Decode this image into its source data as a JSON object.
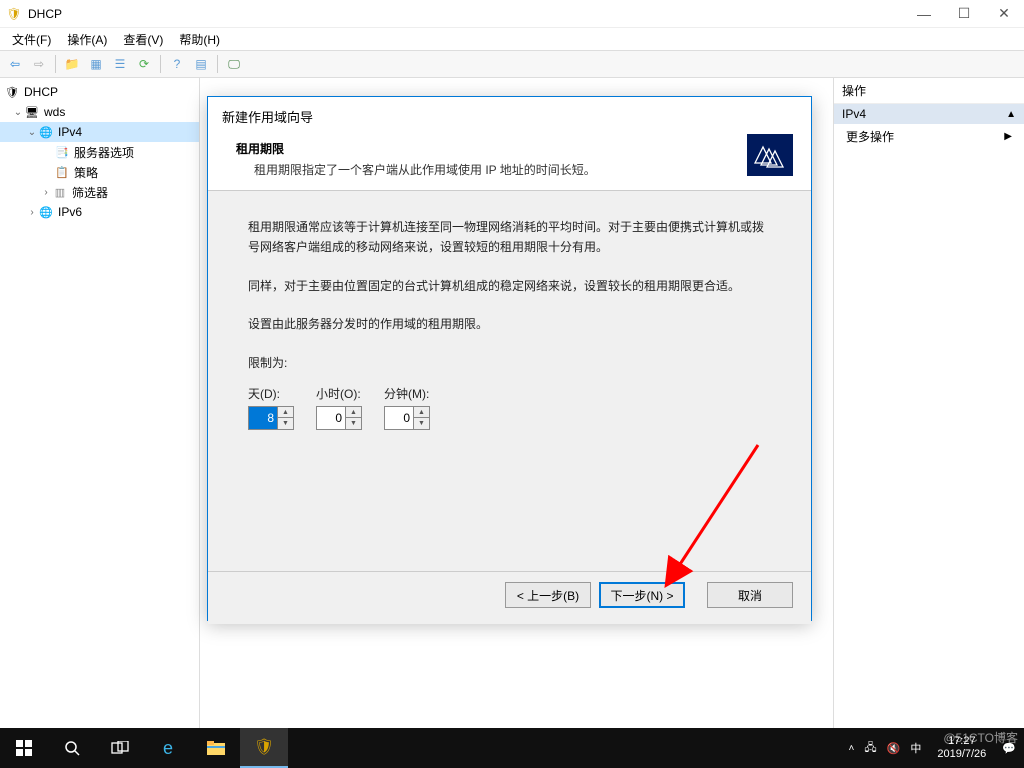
{
  "window": {
    "title": "DHCP",
    "controls": {
      "min": "—",
      "max": "☐",
      "close": "✕"
    }
  },
  "menu": {
    "file": "文件(F)",
    "action": "操作(A)",
    "view": "查看(V)",
    "help": "帮助(H)"
  },
  "tree": {
    "root": "DHCP",
    "server": "wds",
    "ipv4": "IPv4",
    "server_options": "服务器选项",
    "policies": "策略",
    "filters": "筛选器",
    "ipv6": "IPv6"
  },
  "actions_panel": {
    "header": "操作",
    "scope": "IPv4",
    "more": "更多操作"
  },
  "wizard": {
    "window_title": "新建作用域向导",
    "header_title": "租用期限",
    "header_sub": "租用期限指定了一个客户端从此作用域使用 IP 地址的时间长短。",
    "p1": "租用期限通常应该等于计算机连接至同一物理网络消耗的平均时间。对于主要由便携式计算机或拨号网络客户端组成的移动网络来说，设置较短的租用期限十分有用。",
    "p2": "同样，对于主要由位置固定的台式计算机组成的稳定网络来说，设置较长的租用期限更合适。",
    "p3": "设置由此服务器分发时的作用域的租用期限。",
    "limit_label": "限制为:",
    "days_label": "天(D):",
    "hours_label": "小时(O):",
    "minutes_label": "分钟(M):",
    "days_value": "8",
    "hours_value": "0",
    "minutes_value": "0",
    "btn_back": "< 上一步(B)",
    "btn_next": "下一步(N) >",
    "btn_cancel": "取消"
  },
  "taskbar": {
    "time": "17:27",
    "date": "2019/7/26",
    "ime": "中"
  },
  "watermark": "@51CTO博客"
}
